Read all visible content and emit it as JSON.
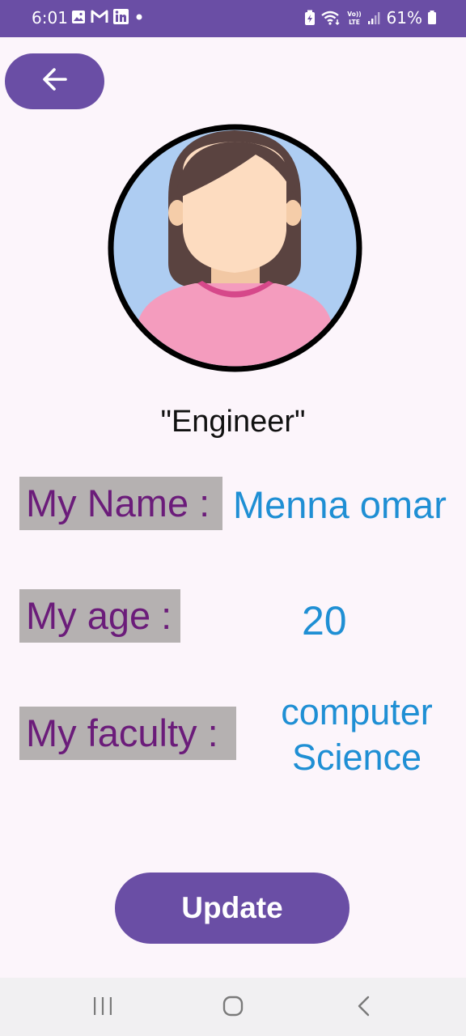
{
  "status_bar": {
    "time": "6:01",
    "battery": "61%",
    "icons_left": [
      "gallery-icon",
      "gmail-icon",
      "linkedin-icon",
      "dot-icon"
    ],
    "icons_right": [
      "battery-saver-icon",
      "wifi-icon",
      "volte-icon",
      "signal-icon",
      "battery-icon"
    ]
  },
  "colors": {
    "primary": "#6a4ea5",
    "label_bg": "#b5b1b1",
    "label_text": "#6b1c7a",
    "value_text": "#1f8fd4",
    "background": "#fcf5fb"
  },
  "header": {
    "back_icon": "arrow-left-icon"
  },
  "profile": {
    "title": "\"Engineer\"",
    "fields": [
      {
        "label": "My Name :",
        "value": "Menna omar"
      },
      {
        "label": "My age :",
        "value": "20"
      },
      {
        "label": "My faculty :",
        "value_line1": "computer",
        "value_line2": "Science"
      }
    ]
  },
  "actions": {
    "update_label": "Update"
  },
  "nav": {
    "items": [
      "recent-apps-icon",
      "home-icon",
      "back-icon"
    ]
  }
}
